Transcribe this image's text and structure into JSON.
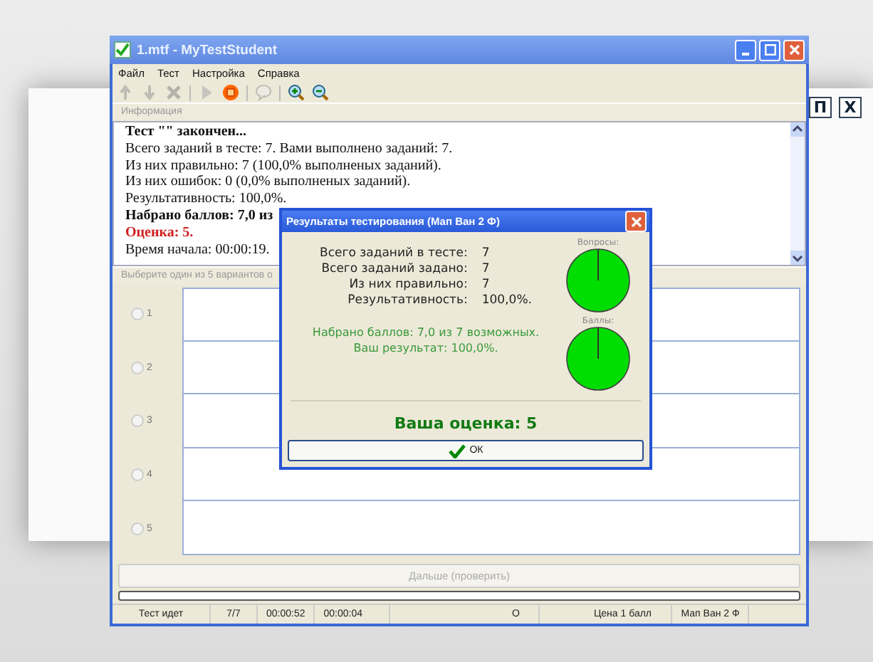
{
  "background": {
    "buttons": [
      "П",
      "X"
    ]
  },
  "window": {
    "title": "1.mtf - MyTestStudent"
  },
  "menu": [
    "Файл",
    "Тест",
    "Настройка",
    "Справка"
  ],
  "toolbar": [
    {
      "kind": "up",
      "disabled": true
    },
    {
      "kind": "down",
      "disabled": true
    },
    {
      "kind": "delete",
      "disabled": true
    },
    {
      "kind": "play",
      "disabled": true
    },
    {
      "kind": "stop",
      "disabled": false
    },
    {
      "kind": "comment",
      "disabled": true
    },
    {
      "kind": "zoom-in",
      "disabled": false
    },
    {
      "kind": "zoom-out",
      "disabled": false
    }
  ],
  "info": {
    "header": "Информация",
    "lines": [
      {
        "text": "Тест \"\" закончен...",
        "kind": "bold"
      },
      {
        "text": "Всего заданий в тесте: 7. Вами выполнено заданий: 7.",
        "kind": "normal"
      },
      {
        "text": "Из них правильно: 7 (100,0% выполненых заданий).",
        "kind": "normal"
      },
      {
        "text": "Из них ошибок: 0 (0,0% выполненых заданий).",
        "kind": "normal"
      },
      {
        "text": "Результативность: 100,0%.",
        "kind": "normal"
      },
      {
        "text": "Набрано баллов: 7,0 из",
        "kind": "bold"
      },
      {
        "text": "Оценка: 5.",
        "kind": "red"
      },
      {
        "text": "Время начала: 00:00:19.",
        "kind": "normal"
      }
    ]
  },
  "question": {
    "header": "Выберите один из 5 вариантов о",
    "options": [
      {
        "label": "1",
        "selected": false
      },
      {
        "label": "2",
        "selected": false
      },
      {
        "label": "3",
        "selected": false
      },
      {
        "label": "4",
        "selected": false
      },
      {
        "label": "5",
        "selected": false
      }
    ]
  },
  "next_button": {
    "label": "Дальше (проверить)",
    "disabled": true
  },
  "progress": {
    "level": 0
  },
  "status_bar": [
    "Тест идет",
    "7/7",
    "00:00:52",
    "00:00:04",
    "O",
    "Цена 1 балл",
    "Мап Ван 2 Ф"
  ],
  "dialog": {
    "title": "Результаты тестирования (Мап Ван 2 Ф)",
    "stats": [
      {
        "label": "Всего заданий в тесте:",
        "value": "7"
      },
      {
        "label": "Всего заданий задано:",
        "value": "7"
      },
      {
        "label": "Из них правильно:",
        "value": "7"
      },
      {
        "label": "Результативность:",
        "value": "100,0%."
      }
    ],
    "score_lines": [
      "Набрано баллов: 7,0 из 7 возможных.",
      "Ваш результат: 100,0%."
    ],
    "pies": [
      "Вопросы:",
      "Баллы:"
    ],
    "grade": "Ваша оценка: 5",
    "ok": "ОК"
  }
}
